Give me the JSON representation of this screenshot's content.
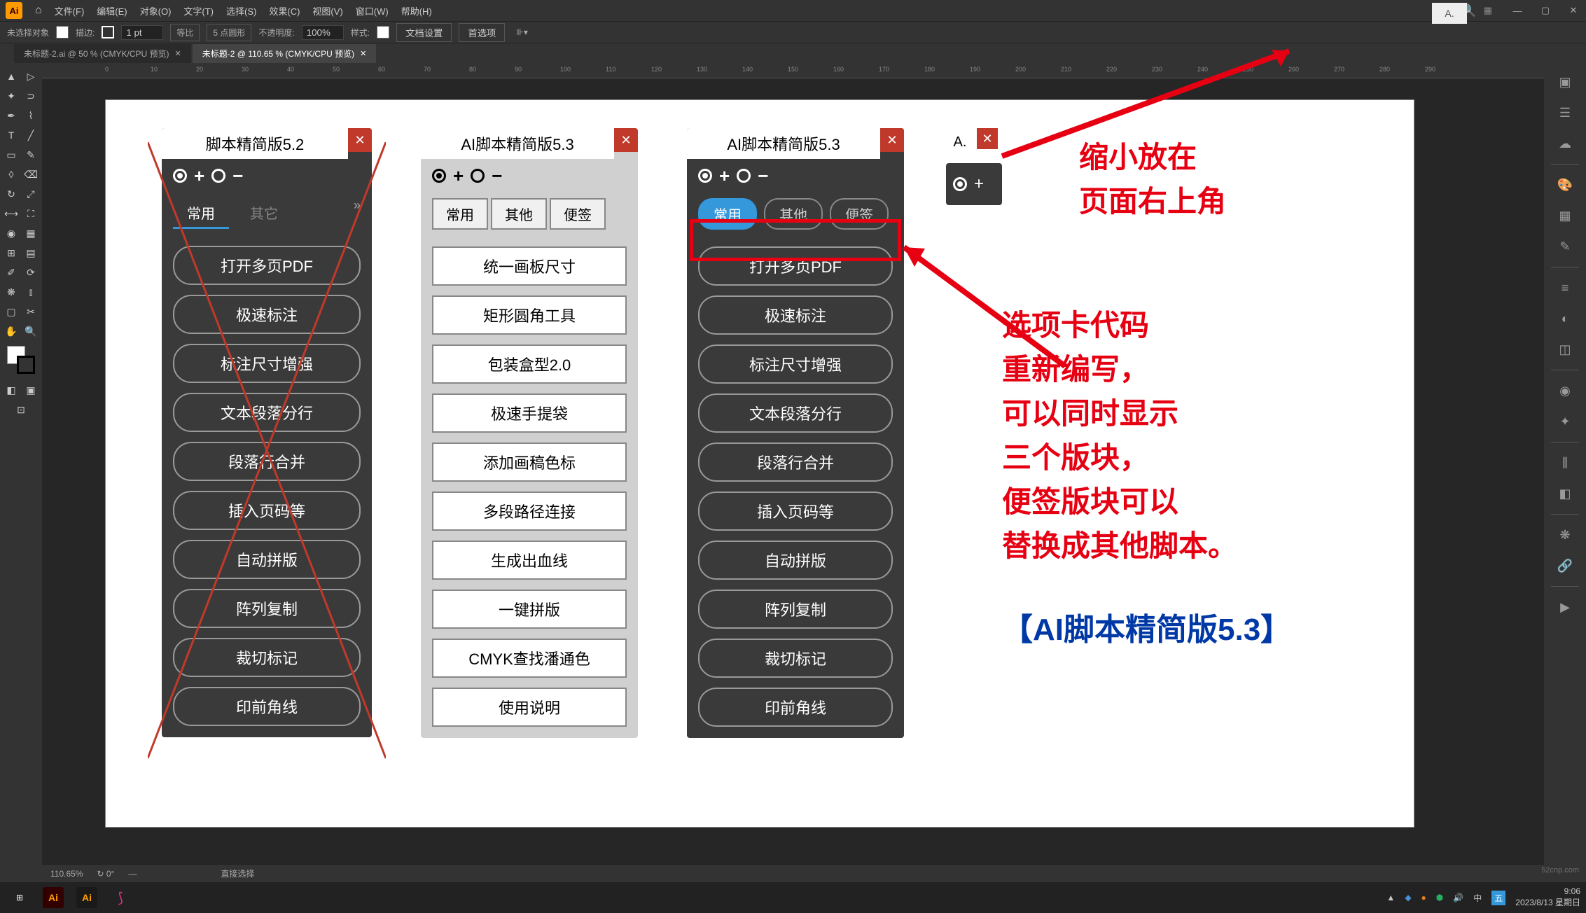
{
  "app": {
    "logo": "Ai"
  },
  "menubar": [
    "文件(F)",
    "编辑(E)",
    "对象(O)",
    "文字(T)",
    "选择(S)",
    "效果(C)",
    "视图(V)",
    "窗口(W)",
    "帮助(H)"
  ],
  "options": {
    "no_sel": "未选择对象",
    "stroke": "描边:",
    "stroke_val": "1 pt",
    "uniform": "等比",
    "pt5": "5 点圆形",
    "opacity": "不透明度:",
    "opacity_val": "100%",
    "style": "样式:",
    "doc_setup": "文档设置",
    "prefs": "首选项"
  },
  "doc_tabs": [
    {
      "label": "未标题-2.ai @ 50 % (CMYK/CPU 预览)",
      "active": false
    },
    {
      "label": "未标题-2 @ 110.65 % (CMYK/CPU 预览)",
      "active": true
    }
  ],
  "ruler_marks": [
    "0",
    "10",
    "20",
    "30",
    "40",
    "50",
    "60",
    "70",
    "80",
    "90",
    "100",
    "110",
    "120",
    "130",
    "140",
    "150",
    "160",
    "170",
    "180",
    "190",
    "200",
    "210",
    "220",
    "230",
    "240",
    "250",
    "260",
    "270",
    "280",
    "290"
  ],
  "panel52": {
    "title": "脚本精简版5.2",
    "tabs": [
      "常用",
      "其它"
    ],
    "buttons": [
      "打开多页PDF",
      "极速标注",
      "标注尺寸增强",
      "文本段落分行",
      "段落行合并",
      "插入页码等",
      "自动拼版",
      "阵列复制",
      "裁切标记",
      "印前角线"
    ]
  },
  "panel53_light": {
    "title": "AI脚本精简版5.3",
    "tabs": [
      "常用",
      "其他",
      "便签"
    ],
    "buttons": [
      "统一画板尺寸",
      "矩形圆角工具",
      "包装盒型2.0",
      "极速手提袋",
      "添加画稿色标",
      "多段路径连接",
      "生成出血线",
      "一键拼版",
      "CMYK查找潘通色",
      "使用说明"
    ]
  },
  "panel53_dark": {
    "title": "AI脚本精简版5.3",
    "tabs": [
      "常用",
      "其他",
      "便签"
    ],
    "buttons": [
      "打开多页PDF",
      "极速标注",
      "标注尺寸增强",
      "文本段落分行",
      "段落行合并",
      "插入页码等",
      "自动拼版",
      "阵列复制",
      "裁切标记",
      "印前角线"
    ]
  },
  "mini": {
    "label": "A."
  },
  "annotations": {
    "shrink": "缩小放在\n页面右上角",
    "tabs_rewrite": "选项卡代码\n重新编写，\n可以同时显示\n三个版块，\n便签版块可以\n替换成其他脚本。",
    "version": "【AI脚本精简版5.3】"
  },
  "status": {
    "zoom": "110.65%",
    "dash": "—",
    "sel": "直接选择"
  },
  "taskbar": {
    "time": "9:06",
    "date": "2023/8/13 星期日",
    "ime": "中",
    "wubi": "五"
  },
  "watermark": "52cnp.com"
}
